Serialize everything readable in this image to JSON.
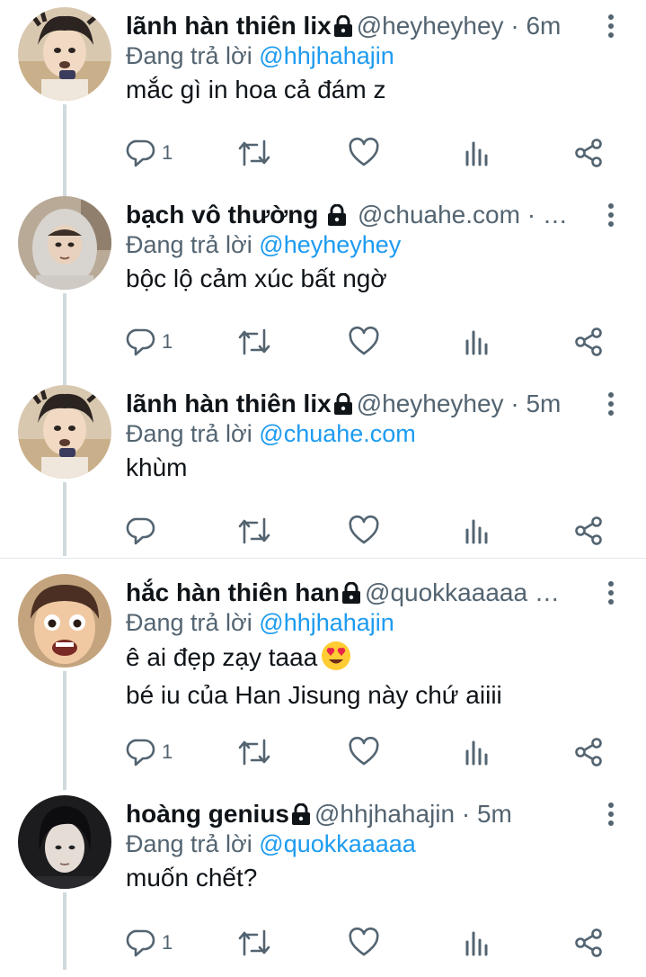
{
  "replying_label": "Đang trả lời",
  "tweets": [
    {
      "name": "lãnh hàn thiên lix",
      "handle": "@heyheyhey",
      "time": "· 6m",
      "replying_to": "@hhjhahajin",
      "lines": [
        "mắc gì in hoa cả đám z"
      ],
      "reply_count": "1",
      "avatar": "avatar-lix"
    },
    {
      "name": "bạch vô thường",
      "handle": "@chuahe.com · …",
      "time": "",
      "replying_to": "@heyheyhey",
      "lines": [
        "bộc lộ cảm xúc bất ngờ"
      ],
      "reply_count": "1",
      "avatar": "avatar-hood"
    },
    {
      "name": "lãnh hàn thiên lix",
      "handle": "@heyheyhey",
      "time": "· 5m",
      "replying_to": "@chuahe.com",
      "lines": [
        "khùm"
      ],
      "reply_count": "",
      "avatar": "avatar-lix"
    },
    {
      "name": "hắc hàn thiên han",
      "handle": "@quokkaaaaa …",
      "time": "",
      "replying_to": "@hhjhahajin",
      "lines": [
        "ê ai đẹp zạy taaa",
        "bé iu của Han Jisung này chứ aiiii"
      ],
      "reply_count": "1",
      "avatar": "avatar-han"
    },
    {
      "name": "hoàng genius",
      "handle": "@hhjhahajin",
      "time": "· 5m",
      "replying_to": "@quokkaaaaa",
      "lines": [
        "muốn chết?"
      ],
      "reply_count": "1",
      "avatar": "avatar-genius"
    }
  ],
  "icons": {
    "reply": "reply-icon",
    "retweet": "retweet-icon",
    "like": "heart-icon",
    "views": "views-icon",
    "share": "share-icon",
    "lock": "lock-icon",
    "more": "more-icon",
    "emoji": "heart-eyes-emoji"
  },
  "colors": {
    "link": "#1d9bf0",
    "secondary_text": "#536471",
    "thread_line": "#cfd9de"
  }
}
